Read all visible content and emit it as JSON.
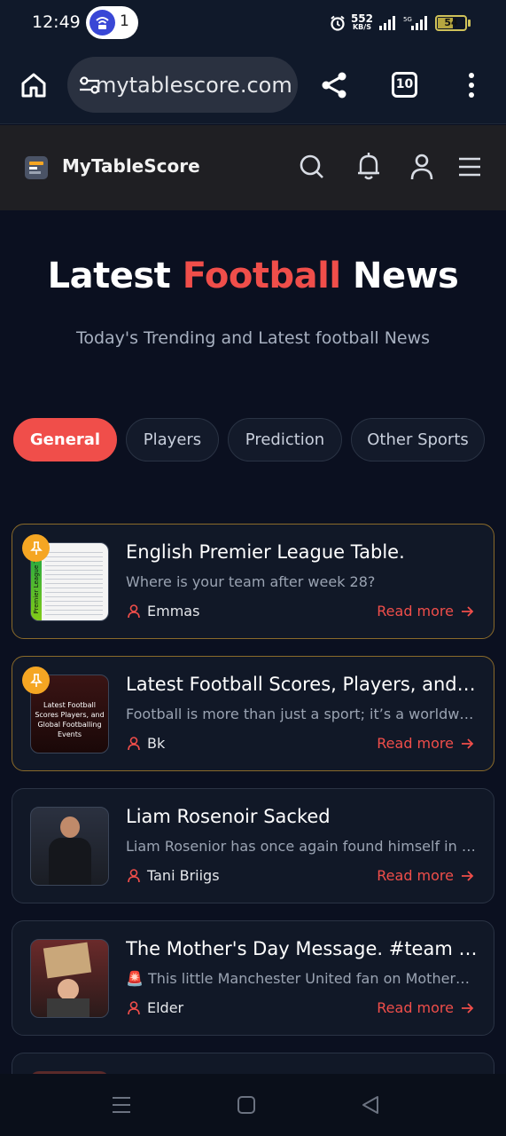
{
  "status": {
    "time": "12:49",
    "hotspot_count": "1",
    "speed_value": "552",
    "speed_unit": "KB/S",
    "battery": "54",
    "network": "5G"
  },
  "browser": {
    "url": "mytablescore.com",
    "tab_count": "10"
  },
  "site": {
    "name": "MyTableScore"
  },
  "hero": {
    "title_pre": "Latest",
    "title_accent": "Football",
    "title_post": "News",
    "subtitle": "Today's Trending and Latest football News"
  },
  "tabs": [
    {
      "label": "General",
      "active": true
    },
    {
      "label": "Players",
      "active": false
    },
    {
      "label": "Prediction",
      "active": false
    },
    {
      "label": "Other Sports",
      "active": false
    }
  ],
  "read_more_label": "Read more",
  "articles": [
    {
      "title": "English Premier League Table.",
      "description": "Where is your team after week 28?",
      "author": "Emmas",
      "pinned": true,
      "thumb_text": "Premier League Table"
    },
    {
      "title": "Latest Football Scores, Players, and Global Footballing Events",
      "description": "Football is more than just a sport; it’s a worldwide phenomenon",
      "author": "Bk",
      "pinned": true,
      "thumb_text": "Latest Football Scores Players, and Global Footballing Events"
    },
    {
      "title": "Liam Rosenoir Sacked",
      "description": "Liam Rosenior has once again found himself in the spotlight",
      "author": "Tani Briigs",
      "pinned": false,
      "thumb_text": ""
    },
    {
      "title": "The Mother's Day Message. #team Manchester United",
      "description": "🚨 This little Manchester United fan on Mothers Day",
      "author": "Elder",
      "pinned": false,
      "thumb_text": ""
    }
  ],
  "colors": {
    "accent": "#f04e4a",
    "background": "#0b1020",
    "card": "#111827",
    "pin": "#f5a623"
  }
}
